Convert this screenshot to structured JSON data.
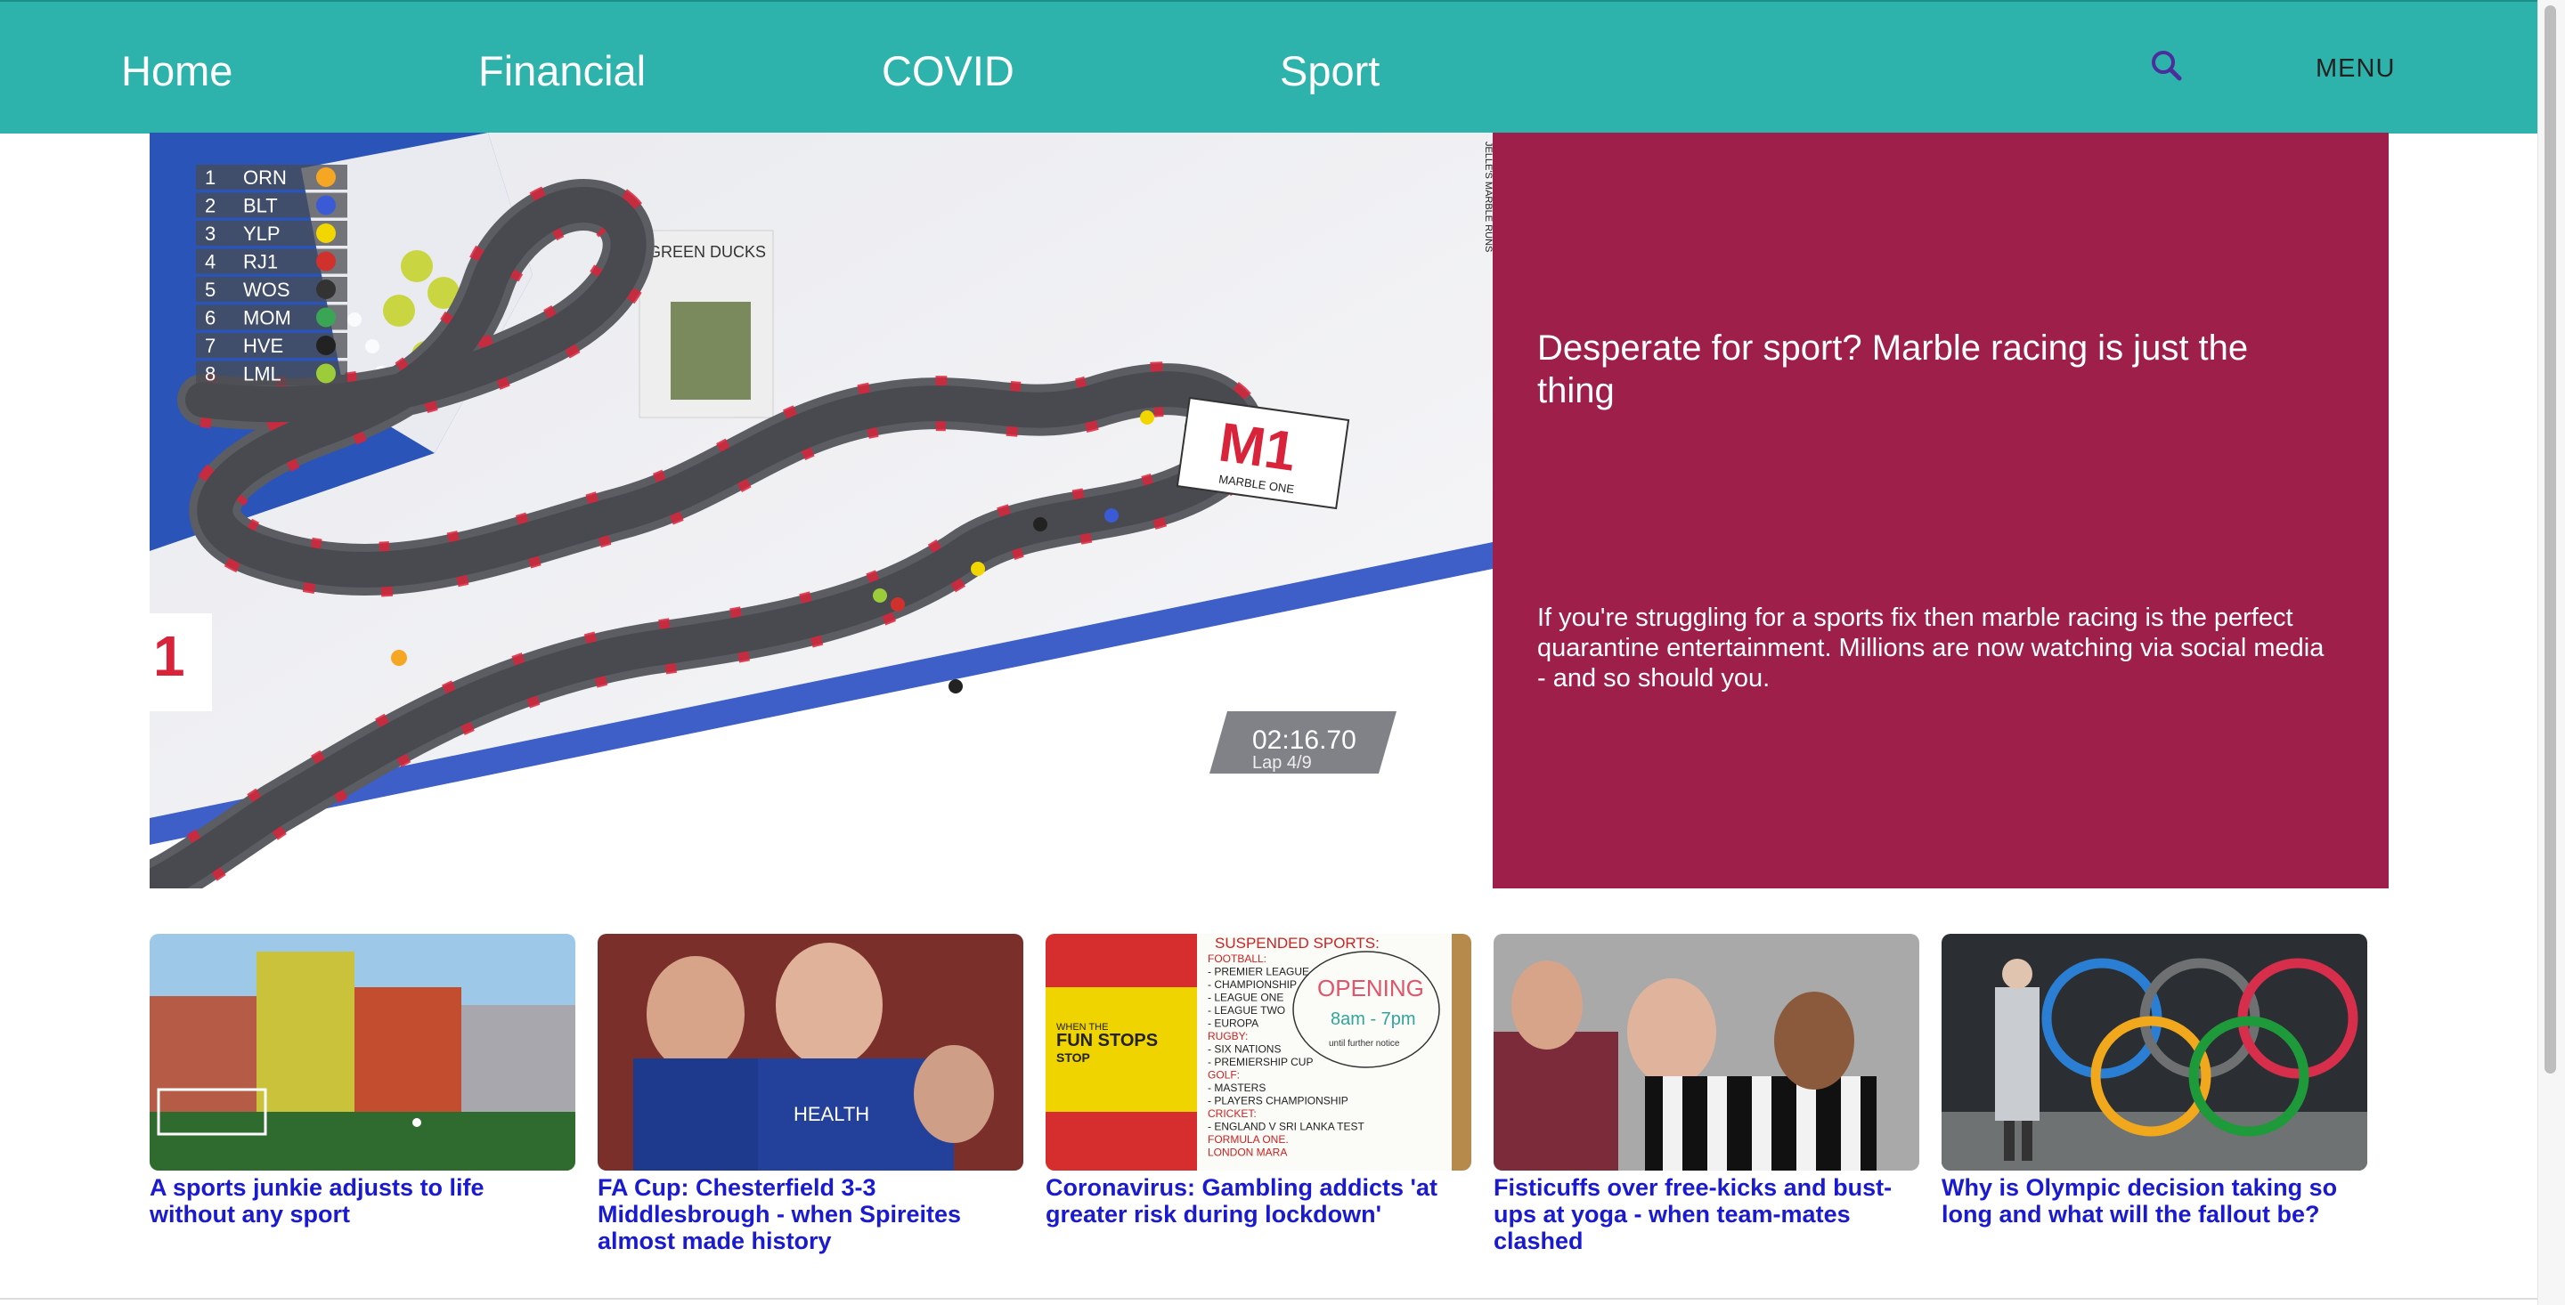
{
  "nav": {
    "links": [
      "Home",
      "Financial",
      "COVID",
      "Sport"
    ],
    "menu_label": "MENU",
    "search_icon": "search-icon",
    "bg_color": "#2db3ab"
  },
  "hero": {
    "title": "Desperate for sport? Marble racing is just the thing",
    "summary": "If you're struggling for a sports fix then marble racing is the perfect quarantine entertainment. Millions are now watching via social media - and so should you.",
    "panel_color": "#9e1f4a",
    "image": {
      "leaderboard": [
        {
          "pos": "1",
          "team": "ORN",
          "color": "#f5a623"
        },
        {
          "pos": "2",
          "team": "BLT",
          "color": "#3b5bd6"
        },
        {
          "pos": "3",
          "team": "YLP",
          "color": "#f2d600"
        },
        {
          "pos": "4",
          "team": "RJ1",
          "color": "#d0312d"
        },
        {
          "pos": "5",
          "team": "WOS",
          "color": "#333333"
        },
        {
          "pos": "6",
          "team": "MOM",
          "color": "#3aa655"
        },
        {
          "pos": "7",
          "team": "HVE",
          "color": "#222222"
        },
        {
          "pos": "8",
          "team": "LML",
          "color": "#9ccc3a"
        }
      ],
      "timer": "02:16.70",
      "lap": "Lap 4/9",
      "sign_logo": "M1",
      "sign_text": "MARBLE ONE",
      "credit": "JELLE'S MARBLE RUNS",
      "board_text": "GREEN DUCKS"
    }
  },
  "cards": [
    {
      "title": "A sports junkie adjusts to life without any sport"
    },
    {
      "title": "FA Cup: Chesterfield 3-3 Middlesbrough - when Spireites almost made history"
    },
    {
      "title": "Coronavirus: Gambling addicts 'at greater risk during lockdown'"
    },
    {
      "title": "Fisticuffs over free-kicks and bust-ups at yoga - when team-mates clashed"
    },
    {
      "title": "Why is Olympic decision taking so long and what will the fallout be?"
    }
  ],
  "card3_board": {
    "heading": "SUSPENDED SPORTS:",
    "lines": [
      "FOOTBALL:",
      "- PREMIER LEAGUE",
      "- CHAMPIONSHIP",
      "- LEAGUE ONE",
      "- LEAGUE TWO",
      "- EUROPA",
      "RUGBY:",
      "- SIX NATIONS",
      "- PREMIERSHIP CUP",
      "GOLF:",
      "- MASTERS",
      "- PLAYERS CHAMPIONSHIP",
      "CRICKET:",
      "- ENGLAND V SRI LANKA TEST",
      "FORMULA ONE.",
      "LONDON MARA"
    ],
    "opening": "OPENING",
    "hours": "8am - 7pm",
    "note": "until further notice",
    "side_sign_a": "WHEN THE",
    "side_sign_b": "FUN STOPS",
    "side_sign_c": "STOP"
  },
  "card2_shirt": {
    "sponsor": "HEALTH"
  }
}
